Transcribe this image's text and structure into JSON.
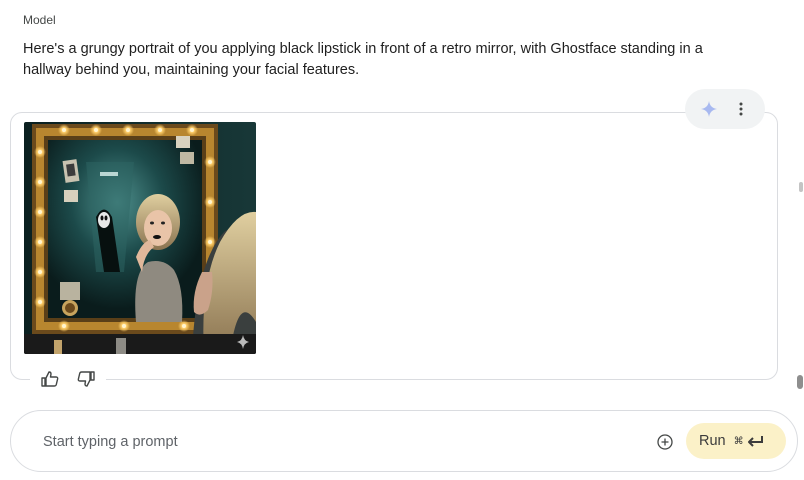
{
  "role_label": "Model",
  "message": "Here's a grungy portrait of you applying black lipstick in front of a retro mirror, with Ghostface standing in a hallway behind you, maintaining your facial features.",
  "image": {
    "subject": "portrait-in-retro-mirror",
    "colors": {
      "frame": "#b8862f",
      "bulbs": "#ffcf6b",
      "hallway": "#1c4a4a",
      "wall": "#0e2626",
      "hair": "#c9b488"
    }
  },
  "toolbar": {
    "icons": [
      "sparkle-icon",
      "more-vert-icon"
    ],
    "sparkle_color": "#a8b9f0"
  },
  "feedback": {
    "icons": [
      "thumbs-up-icon",
      "thumbs-down-icon"
    ]
  },
  "prompt": {
    "placeholder": "Start typing a prompt",
    "value": ""
  },
  "run_button": {
    "label": "Run",
    "shortcut": "⌘",
    "enter_icon": "enter-icon",
    "bg": "#fbf1c8"
  }
}
